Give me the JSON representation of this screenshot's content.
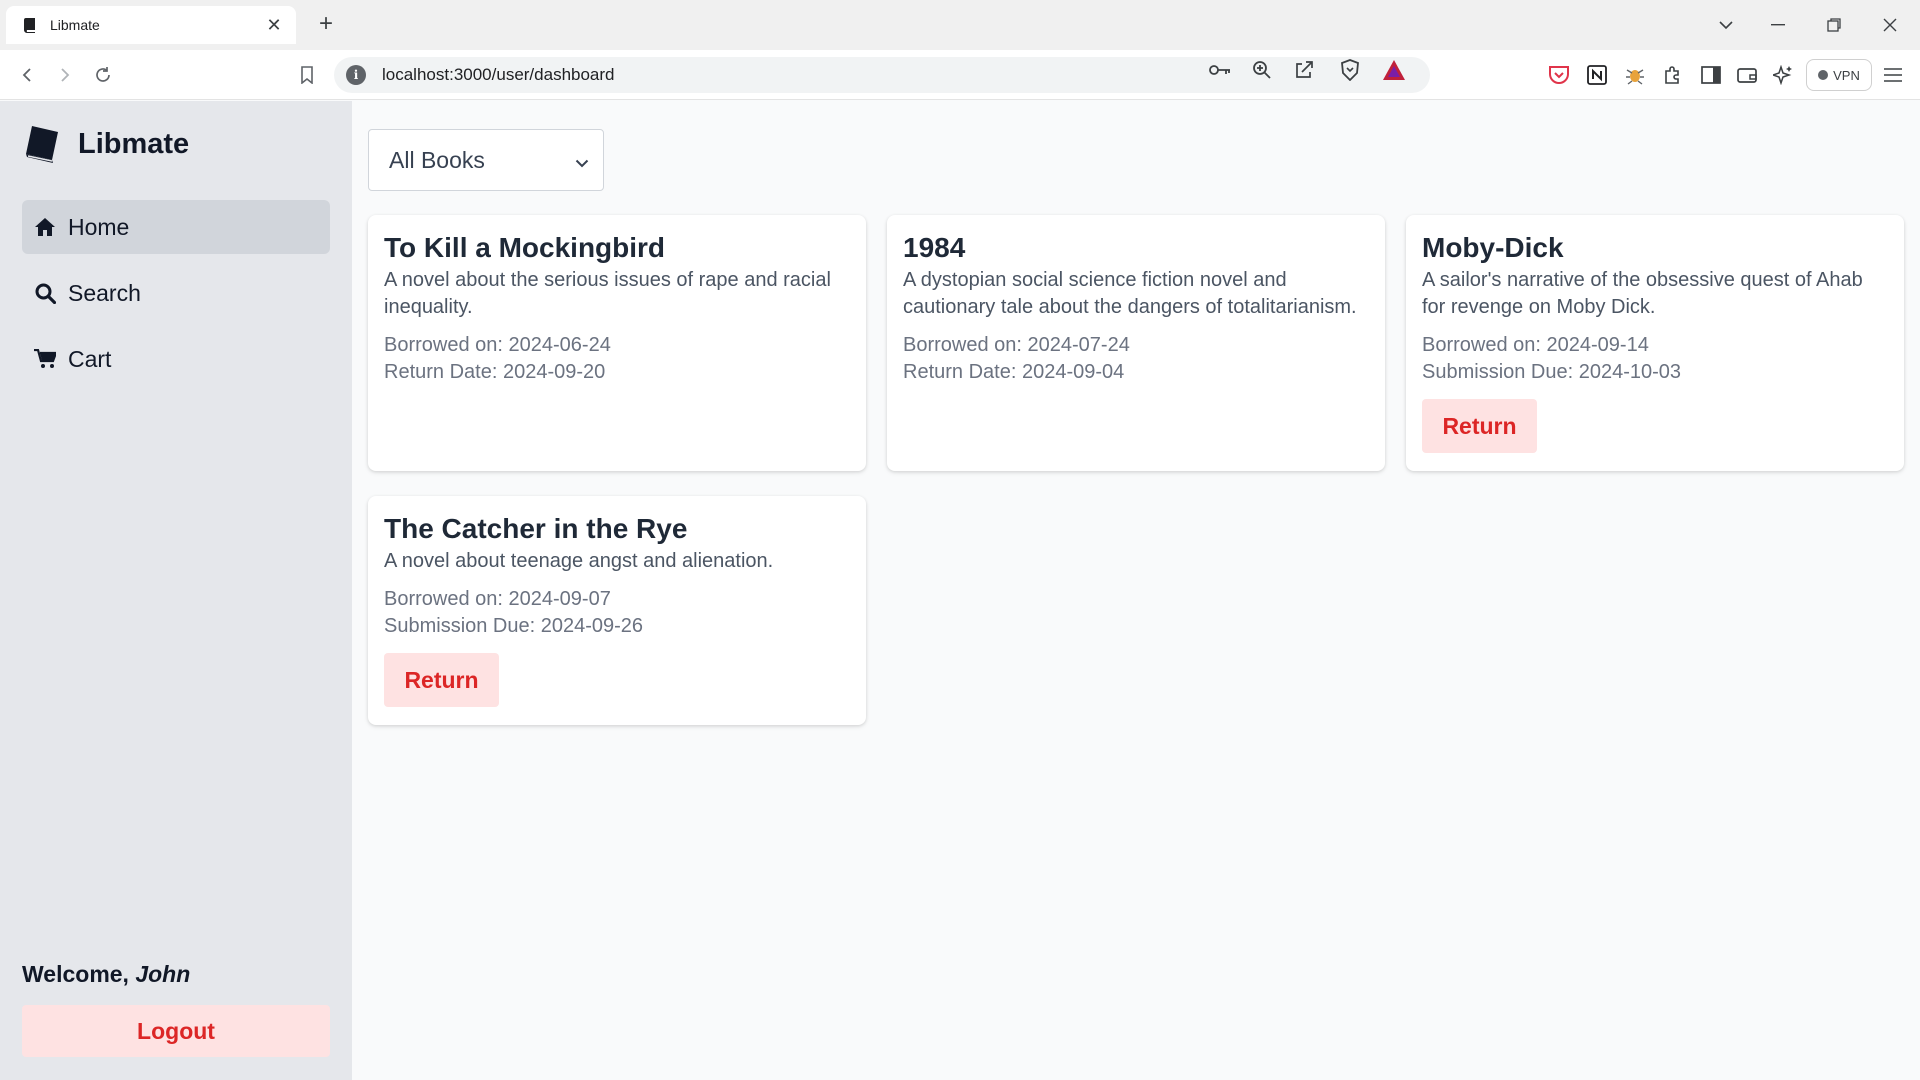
{
  "browser": {
    "tab_title": "Libmate",
    "url": "localhost:3000/user/dashboard",
    "vpn_label": "VPN"
  },
  "sidebar": {
    "brand": "Libmate",
    "items": [
      {
        "label": "Home",
        "icon": "home-icon",
        "active": true
      },
      {
        "label": "Search",
        "icon": "search-icon",
        "active": false
      },
      {
        "label": "Cart",
        "icon": "cart-icon",
        "active": false
      }
    ],
    "welcome_prefix": "Welcome, ",
    "user_name": "John",
    "logout_label": "Logout"
  },
  "main": {
    "filter": {
      "selected": "All Books"
    },
    "books": [
      {
        "title": "To Kill a Mockingbird",
        "description": "A novel about the serious issues of rape and racial inequality.",
        "borrowed": "Borrowed on: 2024-06-24",
        "due": "Return Date: 2024-09-20",
        "action": ""
      },
      {
        "title": "1984",
        "description": "A dystopian social science fiction novel and cautionary tale about the dangers of totalitarianism.",
        "borrowed": "Borrowed on: 2024-07-24",
        "due": "Return Date: 2024-09-04",
        "action": ""
      },
      {
        "title": "Moby-Dick",
        "description": "A sailor's narrative of the obsessive quest of Ahab for revenge on Moby Dick.",
        "borrowed": "Borrowed on: 2024-09-14",
        "due": "Submission Due: 2024-10-03",
        "action": "Return"
      },
      {
        "title": "The Catcher in the Rye",
        "description": "A novel about teenage angst and alienation.",
        "borrowed": "Borrowed on: 2024-09-07",
        "due": "Submission Due: 2024-09-26",
        "action": "Return"
      }
    ]
  },
  "colors": {
    "accent_red": "#dc2626",
    "button_bg": "#fee2e2",
    "sidebar_bg": "#e5e7eb",
    "active_item_bg": "#d1d5db"
  }
}
